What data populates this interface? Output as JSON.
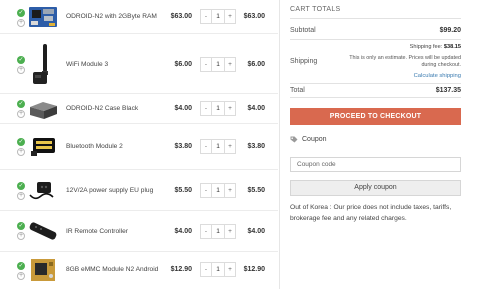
{
  "cart": {
    "items": [
      {
        "name": "ODROID-N2 with 2GByte RAM",
        "price": "$63.00",
        "qty": "1",
        "subtotal": "$63.00",
        "image": "odroid-n2-board"
      },
      {
        "name": "WiFi Module 3",
        "price": "$6.00",
        "qty": "1",
        "subtotal": "$6.00",
        "image": "wifi-dongle-antenna"
      },
      {
        "name": "ODROID-N2 Case Black",
        "price": "$4.00",
        "qty": "1",
        "subtotal": "$4.00",
        "image": "black-case"
      },
      {
        "name": "Bluetooth Module 2",
        "price": "$3.80",
        "qty": "1",
        "subtotal": "$3.80",
        "image": "bluetooth-dongle"
      },
      {
        "name": "12V/2A power supply EU plug",
        "price": "$5.50",
        "qty": "1",
        "subtotal": "$5.50",
        "image": "power-adapter"
      },
      {
        "name": "IR Remote Controller",
        "price": "$4.00",
        "qty": "1",
        "subtotal": "$4.00",
        "image": "ir-remote"
      },
      {
        "name": "8GB eMMC Module N2 Android",
        "price": "$12.90",
        "qty": "1",
        "subtotal": "$12.90",
        "image": "emmc-module"
      }
    ],
    "qty_minus": "-",
    "qty_plus": "+",
    "status_check": "✓",
    "status_add": "+"
  },
  "totals": {
    "title": "CART TOTALS",
    "subtotal_label": "Subtotal",
    "subtotal_value": "$99.20",
    "shipping_label": "Shipping",
    "shipping_fee_label": "Shipping fee:",
    "shipping_fee_value": "$38.15",
    "shipping_note": "This is only an estimate. Prices will be updated during checkout.",
    "calculate_shipping": "Calculate shipping",
    "total_label": "Total",
    "total_value": "$137.35",
    "checkout_button": "PROCEED TO CHECKOUT",
    "coupon_title": "Coupon",
    "coupon_placeholder": "Coupon code",
    "apply_coupon": "Apply coupon",
    "notice": "Out of Korea : Our price does not include taxes, tariffs, brokerage fee and any related charges."
  },
  "colors": {
    "checkout": "#d9694f",
    "status_ok": "#4caf50",
    "link": "#3a7bb0"
  }
}
